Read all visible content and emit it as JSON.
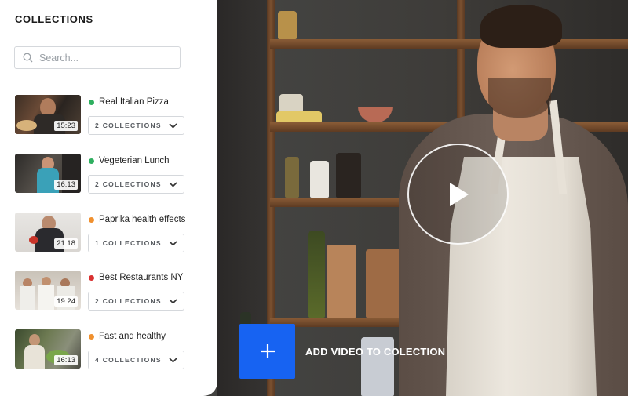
{
  "panel": {
    "title": "COLLECTIONS",
    "search_placeholder": "Search..."
  },
  "videos": [
    {
      "title": "Real Italian Pizza",
      "duration": "15:23",
      "collections": "2 COLLECTIONS",
      "dot_color": "#2eaf5f"
    },
    {
      "title": "Vegeterian Lunch",
      "duration": "16:13",
      "collections": "2 COLLECTIONS",
      "dot_color": "#2eaf5f"
    },
    {
      "title": "Paprika health effects",
      "duration": "21:18",
      "collections": "1 COLLECTIONS",
      "dot_color": "#f0902e"
    },
    {
      "title": "Best Restaurants NY",
      "duration": "19:24",
      "collections": "2 COLLECTIONS",
      "dot_color": "#d93030"
    },
    {
      "title": "Fast and healthy",
      "duration": "16:13",
      "collections": "4 COLLECTIONS",
      "dot_color": "#f0902e"
    }
  ],
  "player": {
    "add_label": "ADD VIDEO TO COLECTION",
    "accent": "#1763f2"
  },
  "icons": [
    "search-icon",
    "chevron-down-icon",
    "play-icon",
    "plus-icon"
  ]
}
